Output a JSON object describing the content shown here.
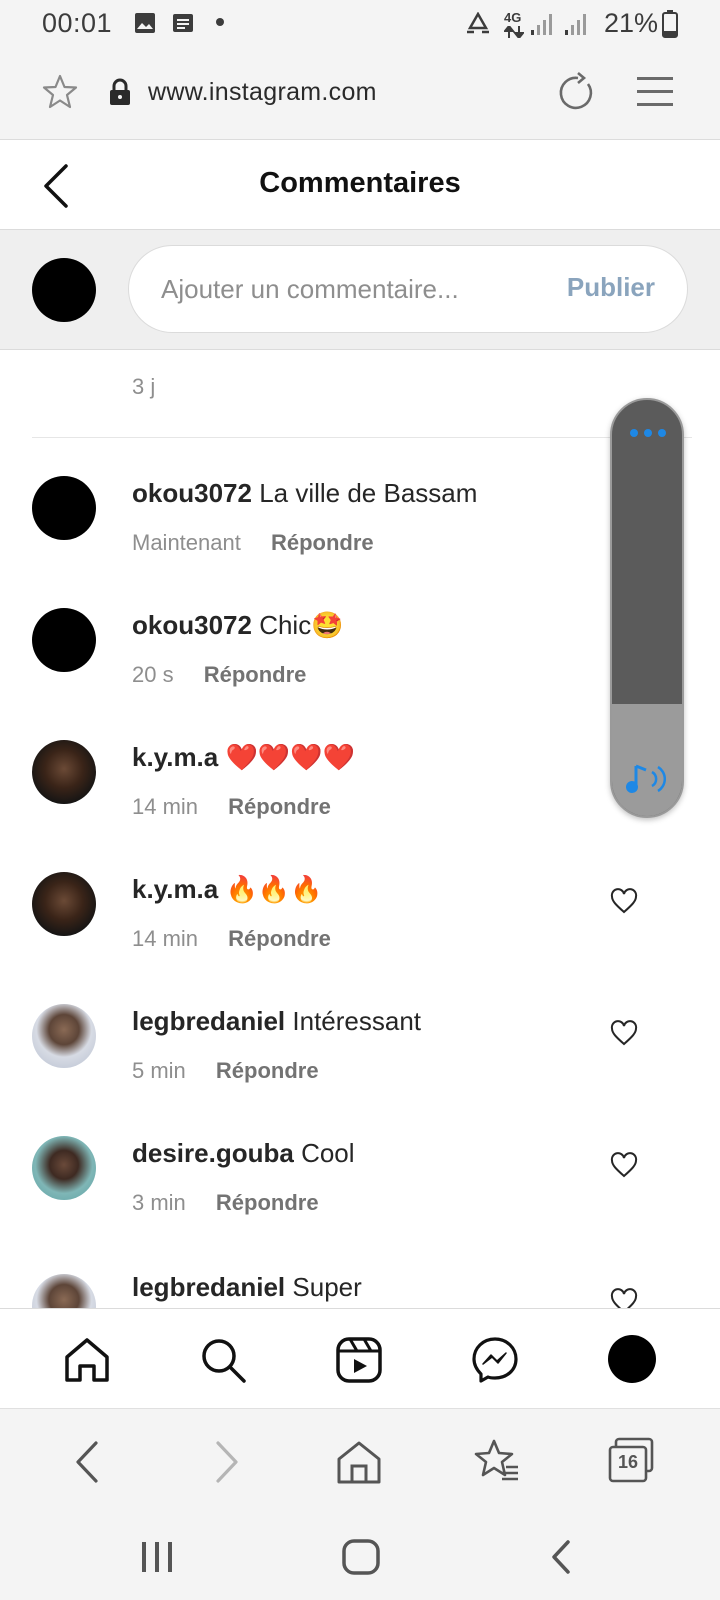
{
  "status_bar": {
    "time": "00:01",
    "network": "4G",
    "battery": "21%"
  },
  "browser": {
    "url": "www.instagram.com"
  },
  "header": {
    "title": "Commentaires"
  },
  "composer": {
    "placeholder": "Ajouter un commentaire...",
    "publish_label": "Publier"
  },
  "top_time": "3 j",
  "comments": [
    {
      "user": "okou3072",
      "text": "La ville de Bassam",
      "time": "Maintenant",
      "reply": "Répondre"
    },
    {
      "user": "okou3072",
      "text": "Chic🤩",
      "time": "20 s",
      "reply": "Répondre"
    },
    {
      "user": "k.y.m.a",
      "text": "❤️❤️❤️❤️",
      "time": "14 min",
      "reply": "Répondre"
    },
    {
      "user": "k.y.m.a",
      "text": "🔥🔥🔥",
      "time": "14 min",
      "reply": "Répondre"
    },
    {
      "user": "legbredaniel",
      "text": "Intéressant",
      "time": "5 min",
      "reply": "Répondre"
    },
    {
      "user": "desire.gouba",
      "text": "Cool",
      "time": "3 min",
      "reply": "Répondre"
    },
    {
      "user": "legbredaniel",
      "text": "Super",
      "time": "",
      "reply": ""
    }
  ],
  "ig_nav": [
    "home-icon",
    "search-icon",
    "reels-icon",
    "messenger-icon",
    "profile-avatar"
  ],
  "browser_toolbar": {
    "tabs_count": "16"
  },
  "colors": {
    "publish": "#8aa4bd",
    "text": "#262626",
    "muted": "#8e8e8e"
  }
}
